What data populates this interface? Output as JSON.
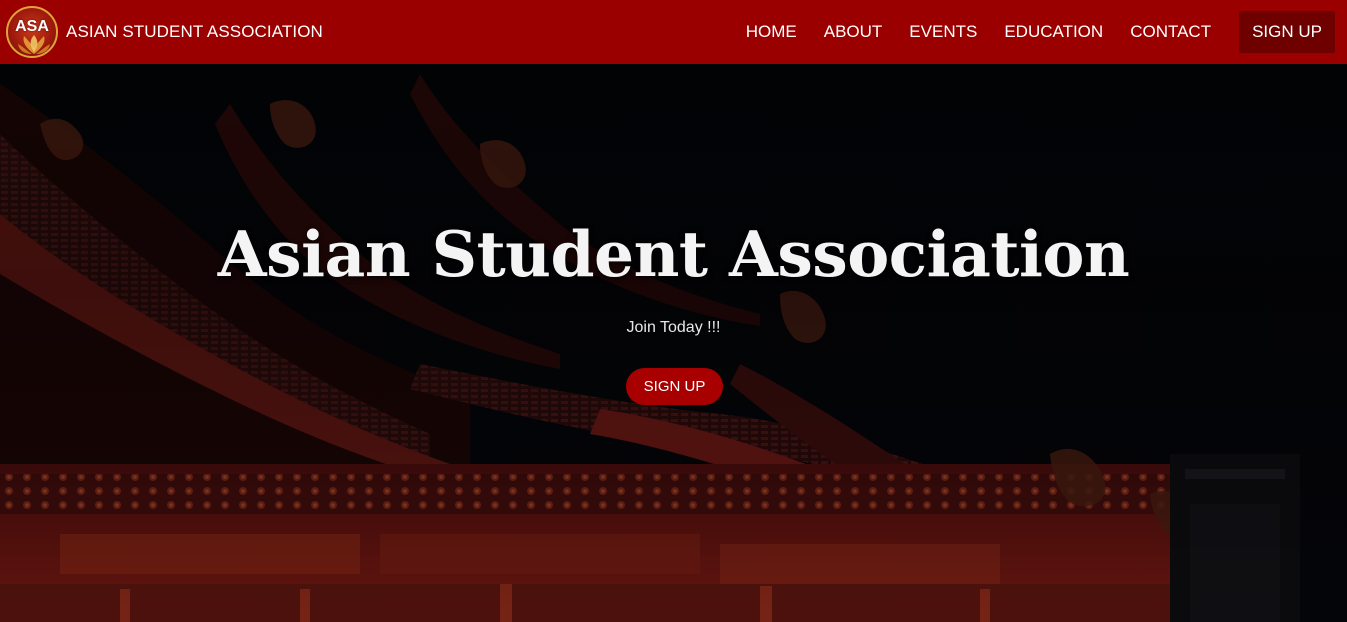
{
  "brand": {
    "logo_text": "ASA",
    "name": "ASIAN STUDENT ASSOCIATION"
  },
  "nav": {
    "items": [
      {
        "label": "HOME"
      },
      {
        "label": "ABOUT"
      },
      {
        "label": "EVENTS"
      },
      {
        "label": "EDUCATION"
      },
      {
        "label": "CONTACT"
      }
    ],
    "signup_label": "SIGN UP"
  },
  "hero": {
    "title": "Asian Student Association",
    "subtitle": "Join Today !!!",
    "button_label": "SIGN UP",
    "background": "temple-roof-night-photo"
  },
  "colors": {
    "navbar": "#9b0000",
    "nav_signup": "#6e0000",
    "hero_button": "#a80000"
  }
}
